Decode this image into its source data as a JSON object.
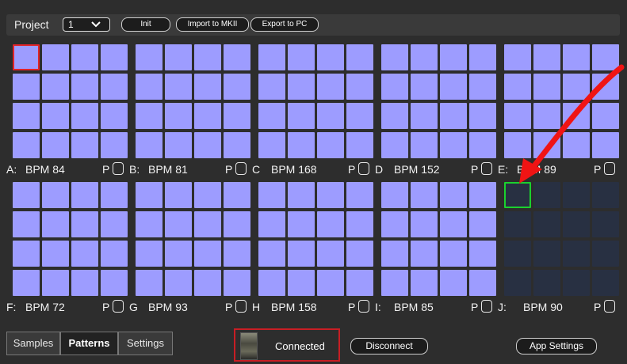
{
  "toolbar": {
    "project_label": "Project",
    "project_value": "1",
    "buttons": {
      "init": "Init",
      "import": "Import to MKII",
      "export": "Export to PC"
    }
  },
  "banks": [
    {
      "letter": "A:",
      "bpm": "BPM 84",
      "p": "P",
      "filled": true
    },
    {
      "letter": "B:",
      "bpm": "BPM 81",
      "p": "P",
      "filled": true
    },
    {
      "letter": "C",
      "bpm": "BPM 168",
      "p": "P",
      "filled": true
    },
    {
      "letter": "D",
      "bpm": "BPM 152",
      "p": "P",
      "filled": true
    },
    {
      "letter": "E:",
      "bpm": "BPM 89",
      "p": "P",
      "filled": true
    },
    {
      "letter": "F:",
      "bpm": "BPM 72",
      "p": "P",
      "filled": true
    },
    {
      "letter": "G",
      "bpm": "BPM 93",
      "p": "P",
      "filled": true
    },
    {
      "letter": "H",
      "bpm": "BPM 158",
      "p": "P",
      "filled": true
    },
    {
      "letter": "I:",
      "bpm": "BPM 85",
      "p": "P",
      "filled": true
    },
    {
      "letter": "J:",
      "bpm": "BPM 90",
      "p": "P",
      "filled": false
    }
  ],
  "tabs": [
    {
      "label": "Samples",
      "active": false
    },
    {
      "label": "Patterns",
      "active": true
    },
    {
      "label": "Settings",
      "active": false
    }
  ],
  "status": {
    "connection": "Connected"
  },
  "buttons": {
    "disconnect": "Disconnect",
    "app_settings": "App Settings"
  },
  "colors": {
    "pad": "#9d9cff",
    "empty_pad": "#283042",
    "selected_border": "#e0242a",
    "highlight_border": "#1bd12e",
    "arrow": "#f01414"
  }
}
